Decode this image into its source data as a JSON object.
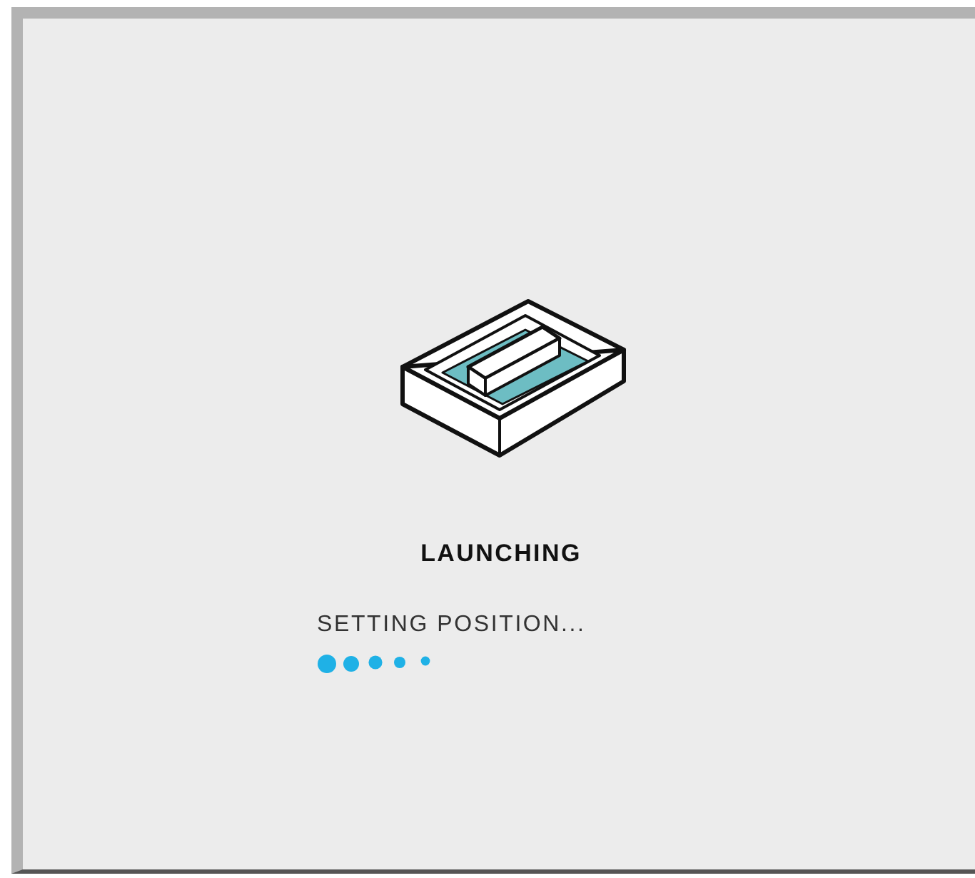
{
  "dialog": {
    "title": "LAUNCHING",
    "status": "SETTING POSITION..."
  }
}
